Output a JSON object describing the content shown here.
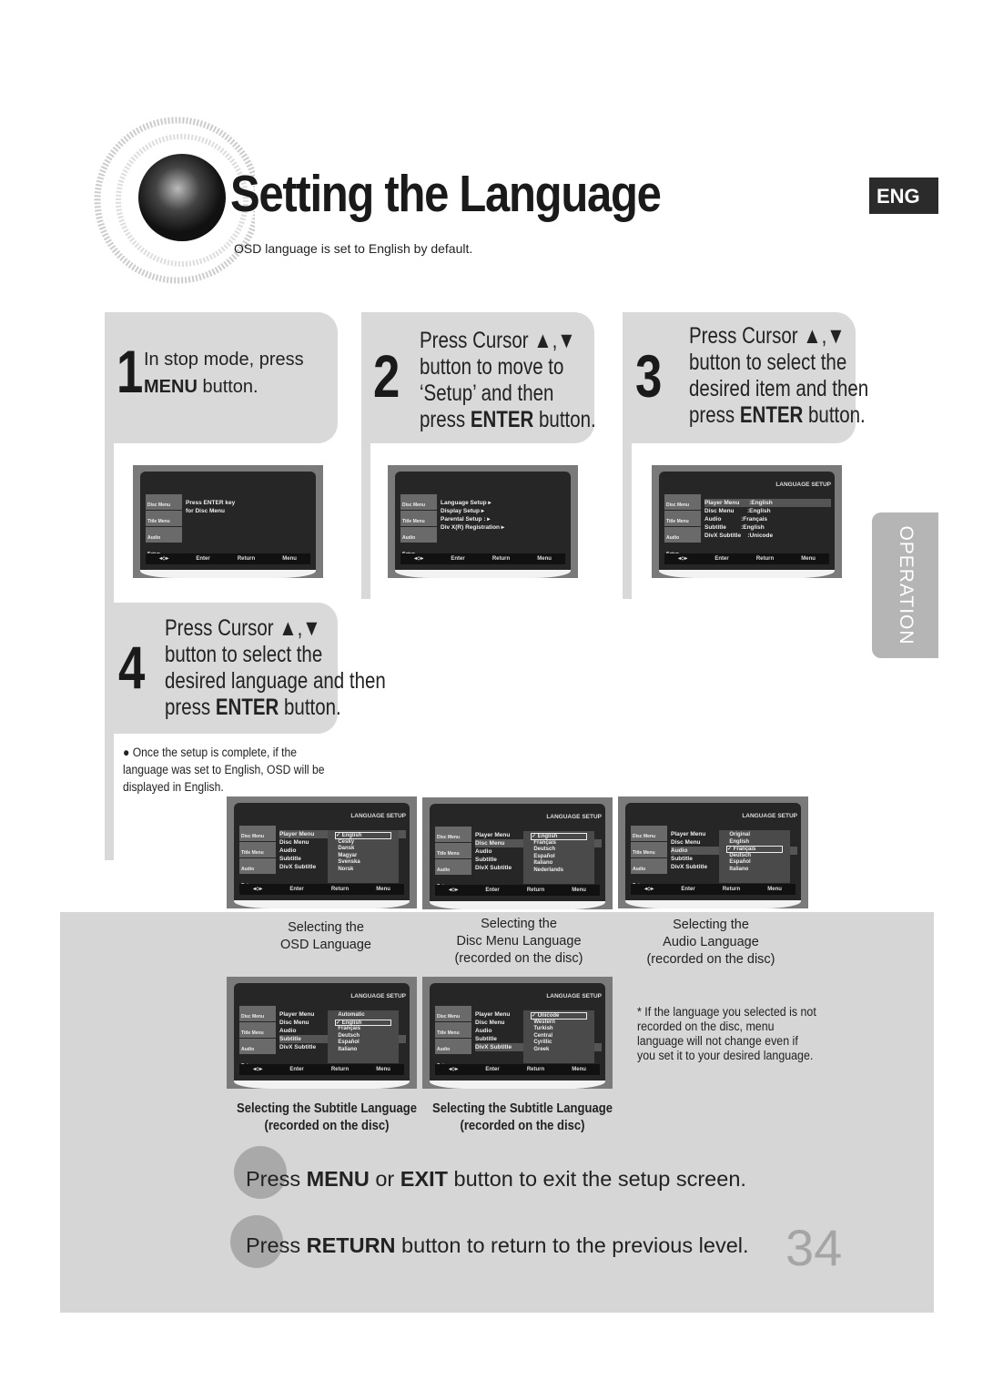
{
  "title": "Setting the Language",
  "lang_badge": "ENG",
  "subtitle": "OSD language is set to English by default.",
  "side_tab": "OPERATION",
  "steps": [
    {
      "num": "1",
      "pre": "In stop mode, press",
      "bold": "MENU",
      "post": " button."
    },
    {
      "num": "2",
      "line1": "Press Cursor ▲,▼",
      "line2": "button to move to",
      "line3": "‘Setup’ and then",
      "line4_pre": "press ",
      "line4_bold": "ENTER",
      "line4_post": " button."
    },
    {
      "num": "3",
      "line1": "Press Cursor ▲,▼",
      "line2": "button to select the",
      "line3": "desired item and then",
      "line4_pre": "press ",
      "line4_bold": "ENTER",
      "line4_post": " button."
    },
    {
      "num": "4",
      "line1": "Press Cursor ▲,▼",
      "line2": "button to select the",
      "line3": "desired language and then",
      "line4_pre": "press ",
      "line4_bold": "ENTER",
      "line4_post": " button."
    }
  ],
  "step4_note": "Once the setup is complete, if the language was set to English, OSD will be displayed in English.",
  "screen_common": {
    "side": [
      "Disc Menu",
      "Title Menu",
      "Audio",
      "Setup"
    ],
    "footer": [
      "◂⬦▸",
      "Enter",
      "Return",
      "Menu"
    ]
  },
  "screens": [
    {
      "header": "",
      "rows": [
        "Press ENTER key",
        "for Disc Menu"
      ],
      "highlight": -1,
      "options": [],
      "selected": -1
    },
    {
      "header": "",
      "rows": [
        "Language Setup ▸",
        "Display Setup ▸",
        "Parental Setup : ▸",
        "Div X(R) Registration ▸"
      ],
      "highlight": -1,
      "options": [],
      "selected": -1
    },
    {
      "header": "LANGUAGE SETUP",
      "rows": [
        "Player Menu      :English",
        "Disc Menu        :English",
        "Audio            :Français",
        "Subtitle         :English",
        "DivX Subtitle    :Unicode"
      ],
      "highlight": 0,
      "options": [],
      "selected": -1
    },
    {
      "header": "LANGUAGE SETUP",
      "rows": [
        "Player Menu",
        "Disc Menu",
        "Audio",
        "Subtitle",
        "DivX Subtitle"
      ],
      "highlight": 0,
      "options": [
        "English",
        "Cesky",
        "Dansk",
        "Magyar",
        "Svenska",
        "Norsk"
      ],
      "selected": 0
    },
    {
      "header": "LANGUAGE SETUP",
      "rows": [
        "Player Menu",
        "Disc Menu",
        "Audio",
        "Subtitle",
        "DivX Subtitle"
      ],
      "highlight": 1,
      "options": [
        "English",
        "Français",
        "Deutsch",
        "Español",
        "Italiano",
        "Nederlands"
      ],
      "selected": 0
    },
    {
      "header": "LANGUAGE SETUP",
      "rows": [
        "Player Menu",
        "Disc Menu",
        "Audio",
        "Subtitle",
        "DivX Subtitle"
      ],
      "highlight": 2,
      "options": [
        "Original",
        "English",
        "Français",
        "Deutsch",
        "Español",
        "Italiano"
      ],
      "selected": 2
    },
    {
      "header": "LANGUAGE SETUP",
      "rows": [
        "Player Menu",
        "Disc Menu",
        "Audio",
        "Subtitle",
        "DivX Subtitle"
      ],
      "highlight": 3,
      "options": [
        "Automatic",
        "English",
        "Français",
        "Deutsch",
        "Español",
        "Italiano"
      ],
      "selected": 1
    },
    {
      "header": "LANGUAGE SETUP",
      "rows": [
        "Player Menu",
        "Disc Menu",
        "Audio",
        "Subtitle",
        "DivX Subtitle"
      ],
      "highlight": 4,
      "options": [
        "Unicode",
        "Western",
        "Turkish",
        "Central",
        "Cyrillic",
        "Greek"
      ],
      "selected": 0
    }
  ],
  "captions": {
    "osd": [
      "Selecting the",
      "OSD Language"
    ],
    "disc": [
      "Selecting the",
      "Disc Menu Language",
      "(recorded on the disc)"
    ],
    "audio": [
      "Selecting the",
      "Audio Language",
      "(recorded on the disc)"
    ],
    "sub1": [
      "Selecting the Subtitle Language",
      "(recorded on the disc)"
    ],
    "sub2": [
      "Selecting the Subtitle Language",
      "(recorded on the disc)"
    ]
  },
  "asterisk_note": "* If the language you selected is not recorded on the disc, menu language will not change even if you set it to your desired language.",
  "bottom": [
    {
      "pre": "Press ",
      "b1": "MENU",
      "mid": " or  ",
      "b2": "EXIT",
      "post": " button to exit the setup screen."
    },
    {
      "pre": "Press ",
      "b1": "RETURN",
      "post": " button to return to the previous level."
    }
  ],
  "page_number": "34"
}
